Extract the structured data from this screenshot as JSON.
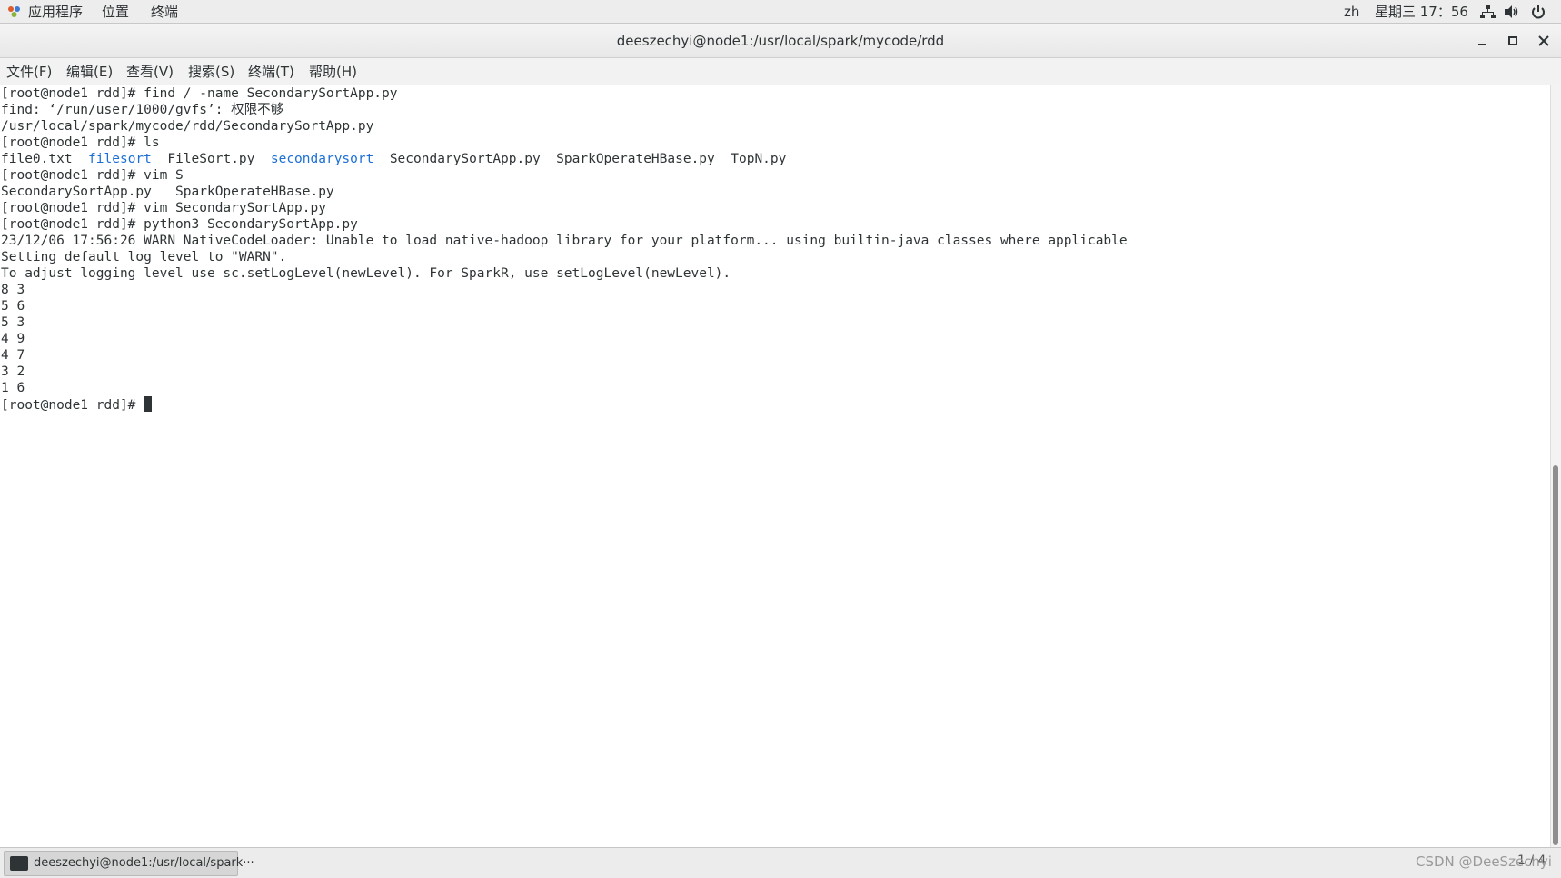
{
  "topbar": {
    "apps_label": "应用程序",
    "places_label": "位置",
    "terminal_label": "终端",
    "lang": "zh",
    "clock": "星期三 17：56"
  },
  "window": {
    "title": "deeszechyi@node1:/usr/local/spark/mycode/rdd"
  },
  "menubar": {
    "file": "文件(F)",
    "edit": "编辑(E)",
    "view": "查看(V)",
    "search": "搜索(S)",
    "terminal": "终端(T)",
    "help": "帮助(H)"
  },
  "terminal": {
    "lines": [
      "[root@node1 rdd]# find / -name SecondarySortApp.py",
      "find: ‘/run/user/1000/gvfs’: 权限不够",
      "/usr/local/spark/mycode/rdd/SecondarySortApp.py",
      "[root@node1 rdd]# ls",
      "",
      "[root@node1 rdd]# vim S",
      "SecondarySortApp.py   SparkOperateHBase.py",
      "[root@node1 rdd]# vim SecondarySortApp.py",
      "[root@node1 rdd]# python3 SecondarySortApp.py",
      "23/12/06 17:56:26 WARN NativeCodeLoader: Unable to load native-hadoop library for your platform... using builtin-java classes where applicable",
      "Setting default log level to \"WARN\".",
      "To adjust logging level use sc.setLogLevel(newLevel). For SparkR, use setLogLevel(newLevel).",
      "8 3",
      "5 6",
      "5 3",
      "4 9",
      "4 7",
      "3 2",
      "1 6"
    ],
    "ls_output": {
      "file0": "file0.txt",
      "filesort_dir": "filesort",
      "filesort_py": "FileSort.py",
      "secondarysort_dir": "secondarysort",
      "secondary_py": "SecondarySortApp.py",
      "spark_py": "SparkOperateHBase.py",
      "topn_py": "TopN.py"
    },
    "prompt": "[root@node1 rdd]# ",
    "dir_color": "#1c6fd6"
  },
  "taskbar": {
    "task_label": "deeszechyi@node1:/usr/local/spark···",
    "pager": "1 / 4",
    "watermark": "CSDN @DeeSzechyi"
  }
}
